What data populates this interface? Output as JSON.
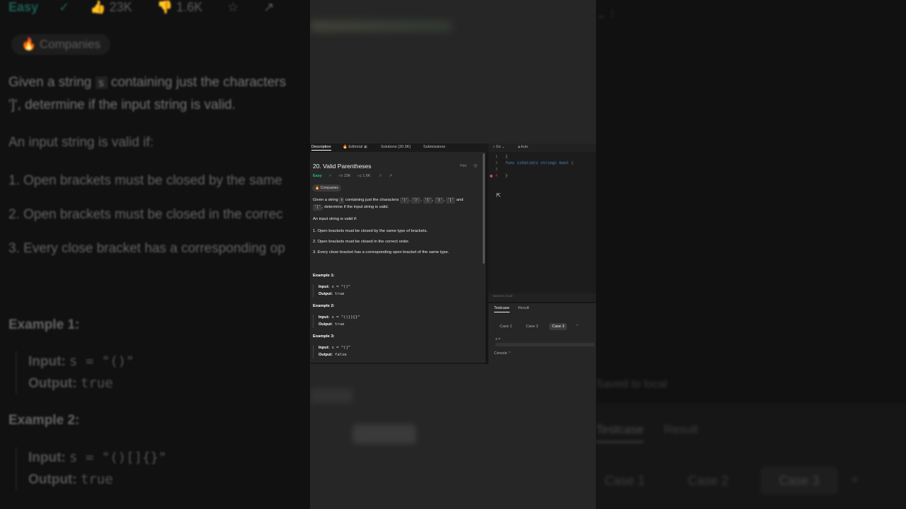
{
  "problem": {
    "title": "20. Valid Parentheses",
    "difficulty": "Easy",
    "likes": "23K",
    "dislikes": "1.6K",
    "companies_label": "Companies",
    "hint_label": "Hint",
    "desc_prefix": "Given a string",
    "desc_var": "s",
    "desc_mid": "containing just the characters",
    "chars": [
      "'('",
      "')'",
      "'{'",
      "'}'",
      "'['"
    ],
    "desc_and": "and",
    "last_char": "']'",
    "desc_end": ", determine if the input string is valid.",
    "valid_if": "An input string is valid if:",
    "rules": [
      "1. Open brackets must be closed by the same type of brackets.",
      "2. Open brackets must be closed in the correct order.",
      "3. Every close bracket has a corresponding open bracket of the same type."
    ],
    "examples": [
      {
        "label": "Example 1:",
        "input": "s = \"()\"",
        "output": "true"
      },
      {
        "label": "Example 2:",
        "input": "s = \"()[]{}\"",
        "output": "true"
      },
      {
        "label": "Example 3:",
        "input": "s = \"(]\"",
        "output": "false"
      }
    ],
    "input_label": "Input:",
    "output_label": "Output:"
  },
  "tabs": [
    "Description",
    "Editorial",
    "Solutions (20.3K)",
    "Submissions"
  ],
  "editor": {
    "language": "Go",
    "mode": "Auto",
    "lines": [
      "1",
      "2",
      "3",
      "4"
    ],
    "code": [
      "{",
      "func isValid(s string) bool {",
      "",
      "}"
    ],
    "saved": "Saved to local"
  },
  "testcase": {
    "tabs": [
      "Testcase",
      "Result"
    ],
    "cases": [
      "Case 1",
      "Case 2",
      "Case 3"
    ],
    "var": "s =",
    "console": "Console"
  },
  "bg_left": {
    "meta_easy": "Easy",
    "likes": "23K",
    "dislikes": "1.6K",
    "companies": "Companies",
    "desc1": "Given a string",
    "var": "s",
    "desc2": "containing just the characters",
    "desc3": "']', determine if the input string is valid.",
    "valid_if": "An input string is valid if:",
    "rules": [
      "1. Open brackets must be closed by the same",
      "2. Open brackets must be closed in the correc",
      "3. Every close bracket has a corresponding op"
    ],
    "ex1": "Example 1:",
    "ex1_in": "s = \"()\"",
    "ex1_out": "true",
    "ex2": "Example 2:",
    "ex2_in": "s = \"()[]{}\"",
    "ex2_out": "true",
    "input_label": "Input:",
    "output_label": "Output:"
  },
  "bg_right": {
    "saved": "Saved to local",
    "tabs": [
      "Testcase",
      "Result"
    ],
    "cases": [
      "Case 1",
      "Case 2",
      "Case 3"
    ]
  },
  "colors": {
    "easy": "#1cb8a0",
    "accepted": "#27c36a",
    "panel": "#262626",
    "background": "#111111"
  }
}
